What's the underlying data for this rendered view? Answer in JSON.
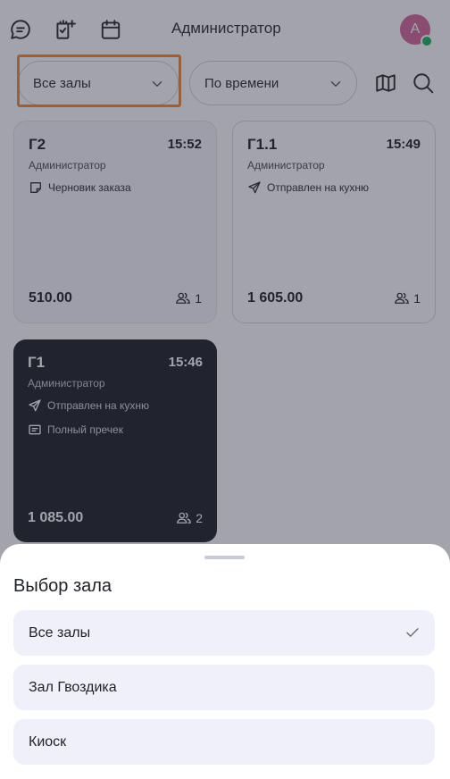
{
  "header": {
    "title": "Администратор",
    "avatar_letter": "А"
  },
  "filters": {
    "hall": "Все залы",
    "sort": "По времени"
  },
  "orders": [
    {
      "name": "Г2",
      "time": "15:52",
      "user": "Администратор",
      "statuses": [
        "Черновик заказа"
      ],
      "total": "510.00",
      "guests": "1"
    },
    {
      "name": "Г1.1",
      "time": "15:49",
      "user": "Администратор",
      "statuses": [
        "Отправлен на кухню"
      ],
      "total": "1 605.00",
      "guests": "1"
    },
    {
      "name": "Г1",
      "time": "15:46",
      "user": "Администратор",
      "statuses": [
        "Отправлен на кухню",
        "Полный пречек"
      ],
      "total": "1 085.00",
      "guests": "2"
    }
  ],
  "sheet": {
    "title": "Выбор зала",
    "options": [
      "Все залы",
      "Зал Гвоздика",
      "Киоск"
    ],
    "selected_index": 0
  }
}
